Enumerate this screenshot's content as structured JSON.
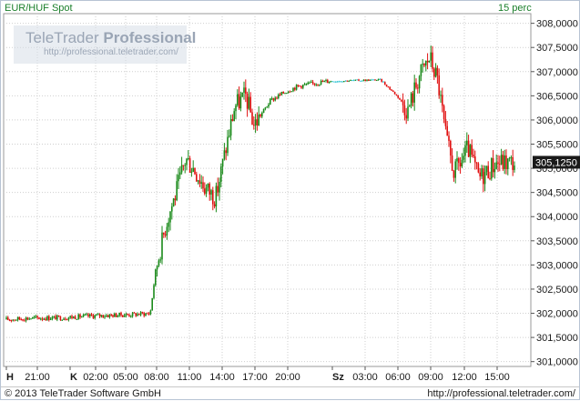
{
  "header": {
    "symbol": "EUR/HUF Spot",
    "interval": "15 perc"
  },
  "watermark": {
    "brand_light": "TeleTrader ",
    "brand_bold": "Professional",
    "url": "http://professional.teletrader.com/"
  },
  "footer": {
    "copyright": "© 2013 TeleTrader Software GmbH",
    "url": "http://professional.teletrader.com/"
  },
  "colors": {
    "up": "#1a8a1a",
    "down": "#e01010",
    "flat": "#35c5d5",
    "grid": "#cfcfcf",
    "last_price_bg": "#1a1a1a"
  },
  "chart_data": {
    "type": "candlestick",
    "y_ticks": [
      "301,0000",
      "301,5000",
      "302,0000",
      "302,5000",
      "303,0000",
      "303,5000",
      "304,0000",
      "304,5000",
      "305,0000",
      "305,5000",
      "306,0000",
      "306,5000",
      "307,0000",
      "307,5000",
      "308,0000"
    ],
    "ylim": [
      300.9,
      308.2
    ],
    "x_ticks": [
      {
        "label": "H",
        "bold": true
      },
      {
        "label": "21:00"
      },
      {
        "label": "K",
        "bold": true
      },
      {
        "label": "02:00"
      },
      {
        "label": "05:00"
      },
      {
        "label": "08:00"
      },
      {
        "label": "11:00"
      },
      {
        "label": "14:00"
      },
      {
        "label": "17:00"
      },
      {
        "label": "20:00"
      },
      {
        "label": "Sz",
        "bold": true
      },
      {
        "label": "03:00"
      },
      {
        "label": "06:00"
      },
      {
        "label": "09:00"
      },
      {
        "label": "12:00"
      },
      {
        "label": "15:00"
      }
    ],
    "last_price": {
      "value": 305.125,
      "label": "305,1250"
    },
    "price_path": [
      [
        "H 18:00",
        301.86
      ],
      [
        "H 21:00",
        301.9
      ],
      [
        "K 00:00",
        301.91
      ],
      [
        "K 03:00",
        301.95
      ],
      [
        "K 06:00",
        301.97
      ],
      [
        "K 08:00",
        302.0
      ],
      [
        "K 08:30",
        302.9
      ],
      [
        "K 09:30",
        303.9
      ],
      [
        "K 10:30",
        304.6
      ],
      [
        "K 11:15",
        305.2
      ],
      [
        "K 12:00",
        305.0
      ],
      [
        "K 13:00",
        304.6
      ],
      [
        "K 14:00",
        304.4
      ],
      [
        "K 15:00",
        305.5
      ],
      [
        "K 15:45",
        306.3
      ],
      [
        "K 16:45",
        306.5
      ],
      [
        "K 17:30",
        305.9
      ],
      [
        "K 19:00",
        306.4
      ],
      [
        "K 20:30",
        306.6
      ],
      [
        "K 21:30",
        306.7
      ],
      [
        "Sz 00:00",
        306.8
      ],
      [
        "Sz 03:00",
        306.82
      ],
      [
        "Sz 05:00",
        306.83
      ],
      [
        "Sz 06:30",
        306.5
      ],
      [
        "Sz 07:30",
        306.2
      ],
      [
        "Sz 08:30",
        306.9
      ],
      [
        "Sz 09:30",
        307.3
      ],
      [
        "Sz 10:15",
        306.8
      ],
      [
        "Sz 11:00",
        305.6
      ],
      [
        "Sz 11:45",
        304.9
      ],
      [
        "Sz 13:00",
        305.4
      ],
      [
        "Sz 14:00",
        304.8
      ],
      [
        "Sz 15:00",
        305.0
      ],
      [
        "Sz 15:30",
        305.12
      ]
    ]
  }
}
